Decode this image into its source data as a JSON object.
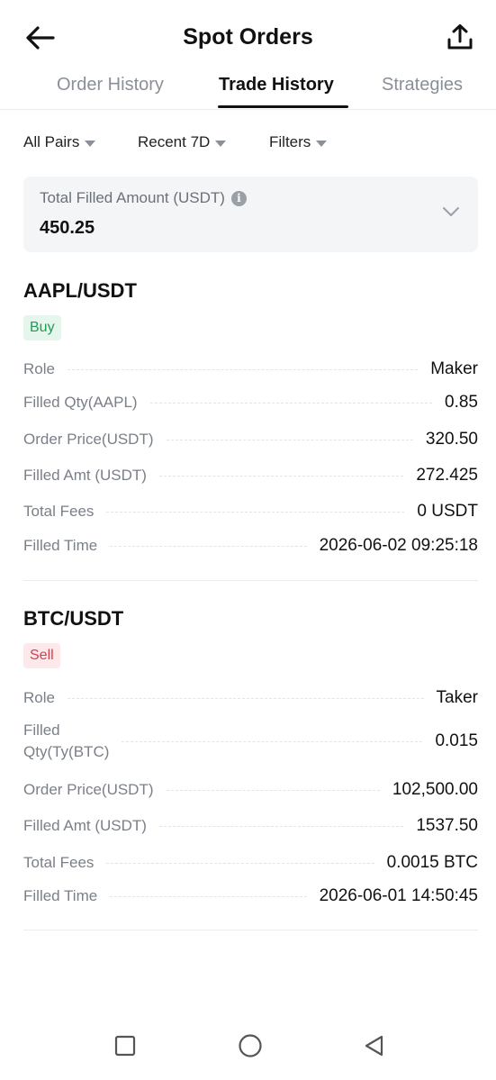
{
  "header": {
    "title": "Spot Orders",
    "back_icon": "arrow-left-icon",
    "share_icon": "share-upload-icon"
  },
  "tabs": {
    "cut_off": ")",
    "items": [
      {
        "label": "Order History",
        "active": false
      },
      {
        "label": "Trade History",
        "active": true
      },
      {
        "label": "Strategies",
        "active": false
      }
    ]
  },
  "filters": {
    "pairs": "All Pairs",
    "period": "Recent 7D",
    "more": "Filters"
  },
  "summary": {
    "label": "Total Filled Amount (USDT)",
    "value": "450.25",
    "info_icon": "info-icon",
    "expand_icon": "chevron-down-icon"
  },
  "trades": [
    {
      "pair": "AAPL/USDT",
      "side": "Buy",
      "rows": [
        {
          "label": "Role",
          "value": "Maker"
        },
        {
          "label": "Filled Qty(AAPL)",
          "value": "0.85"
        },
        {
          "label": "Order Price(USDT)",
          "value": "320.50"
        },
        {
          "label": "Filled Amt (USDT)",
          "value": "272.425"
        },
        {
          "label": "Total Fees",
          "value": "0 USDT"
        },
        {
          "label": "Filled Time",
          "value": "2026-06-02 09:25:18"
        }
      ]
    },
    {
      "pair": "BTC/USDT",
      "side": "Sell",
      "rows": [
        {
          "label": "Role",
          "value": "Taker"
        },
        {
          "label": "Filled",
          "label2": "Qty(Ty(BTC)",
          "value": "0.015"
        },
        {
          "label": "Order Price(USDT)",
          "value": "102,500.00"
        },
        {
          "label": "Filled Amt (USDT)",
          "value": "1537.50"
        },
        {
          "label": "Total Fees",
          "value": "0.0015 BTC"
        },
        {
          "label": "Filled Time",
          "value": "2026-06-01 14:50:45"
        }
      ]
    }
  ],
  "colors": {
    "buy": "#1f9d55",
    "buy_bg": "#e5f6ec",
    "sell": "#d23f4f",
    "sell_bg": "#fde8ea",
    "muted_text": "#7a7f88",
    "card_bg": "#f4f5f7"
  },
  "navbar": {
    "icons": [
      "recents-square-icon",
      "home-circle-icon",
      "back-triangle-icon"
    ]
  }
}
